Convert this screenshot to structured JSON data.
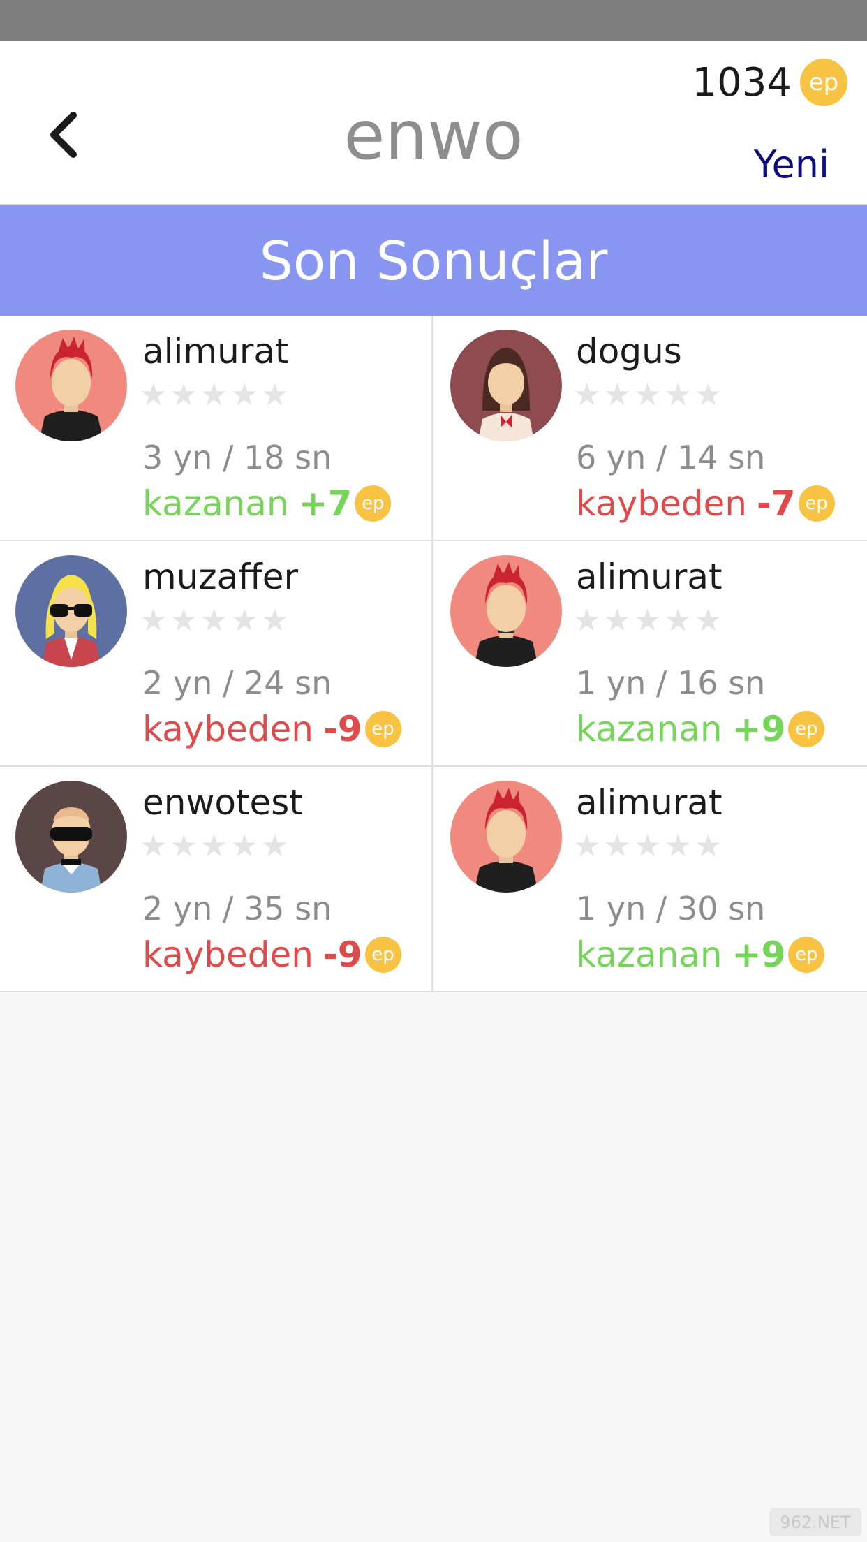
{
  "header": {
    "title": "enwo",
    "points": "1034",
    "coin_label": "ep",
    "new_label": "Yeni"
  },
  "banner": {
    "title": "Son Sonuçlar"
  },
  "results": [
    {
      "name": "alimurat",
      "stat": "3 yn /  18 sn",
      "outcome": "kazanan",
      "delta": "+7",
      "coin": "ep",
      "status": "win",
      "rating": 0
    },
    {
      "name": "dogus",
      "stat": "6 yn /  14 sn",
      "outcome": "kaybeden",
      "delta": "-7",
      "coin": "ep",
      "status": "lose",
      "rating": 0
    },
    {
      "name": "muzaffer",
      "stat": "2 yn /  24 sn",
      "outcome": "kaybeden",
      "delta": "-9",
      "coin": "ep",
      "status": "lose",
      "rating": 0
    },
    {
      "name": "alimurat",
      "stat": "1 yn /  16 sn",
      "outcome": "kazanan",
      "delta": "+9",
      "coin": "ep",
      "status": "win",
      "rating": 0
    },
    {
      "name": "enwotest",
      "stat": "2 yn /  35 sn",
      "outcome": "kaybeden",
      "delta": "-9",
      "coin": "ep",
      "status": "lose",
      "rating": 0
    },
    {
      "name": "alimurat",
      "stat": "1 yn /  30 sn",
      "outcome": "kazanan",
      "delta": "+9",
      "coin": "ep",
      "status": "win",
      "rating": 0
    }
  ],
  "colors": {
    "banner": "#8896f2",
    "win": "#75d559",
    "lose": "#e04a4a",
    "coin": "#f8c243",
    "new_link": "#0d0d7e"
  },
  "icons": {
    "back": "chevron-left-icon",
    "coin": "ep-coin-icon",
    "star": "star-icon"
  },
  "watermark": "962.NET"
}
